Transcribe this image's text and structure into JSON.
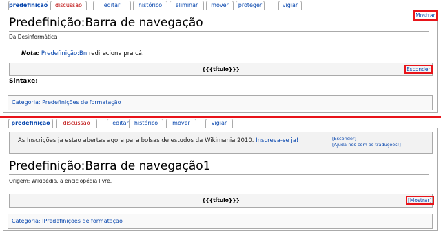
{
  "top": {
    "tabs": [
      {
        "label": "predefinição"
      },
      {
        "label": "discussão"
      },
      {
        "label": "editar"
      },
      {
        "label": "histórico"
      },
      {
        "label": "eliminar"
      },
      {
        "label": "mover"
      },
      {
        "label": "proteger"
      },
      {
        "label": "vigiar"
      }
    ],
    "show_label": "Mostrar",
    "title": "Predefinição:Barra de navegação",
    "subtitle": "Da Desinformática",
    "note_label": "Nota:",
    "note_link": "Predefinição:Bn",
    "note_text": " redireciona pra cá.",
    "navbox_title": "{{{título}}}",
    "navbox_toggle": "Esconder",
    "syntax_label": "Sintaxe:",
    "category": "Categoria: Predefinições de formatação"
  },
  "bottom": {
    "tabs": [
      {
        "label": "predefinição"
      },
      {
        "label": "discussão"
      },
      {
        "label": "editar"
      },
      {
        "label": "histórico"
      },
      {
        "label": "mover"
      },
      {
        "label": "vigiar"
      }
    ],
    "notice_text": "As Inscrições ja estao abertas agora para bolsas de estudos da Wikimania 2010. ",
    "notice_link": "Inscreva-se ja!",
    "notice_hide": "[Esconder]",
    "notice_help": "[Ajuda-nos com as traduções!]",
    "title": "Predefinição:Barra de navegação1",
    "subtitle": "Origem: Wikipédia, a enciclopédia livre.",
    "navbox_title": "{{{título}}}",
    "navbox_toggle": "[Mostrar]",
    "category": "Categoria: IPredefinições de formatação"
  },
  "colors": {
    "link": "#0645ad",
    "redlink": "#ba0000",
    "highlight": "#e8141a"
  }
}
